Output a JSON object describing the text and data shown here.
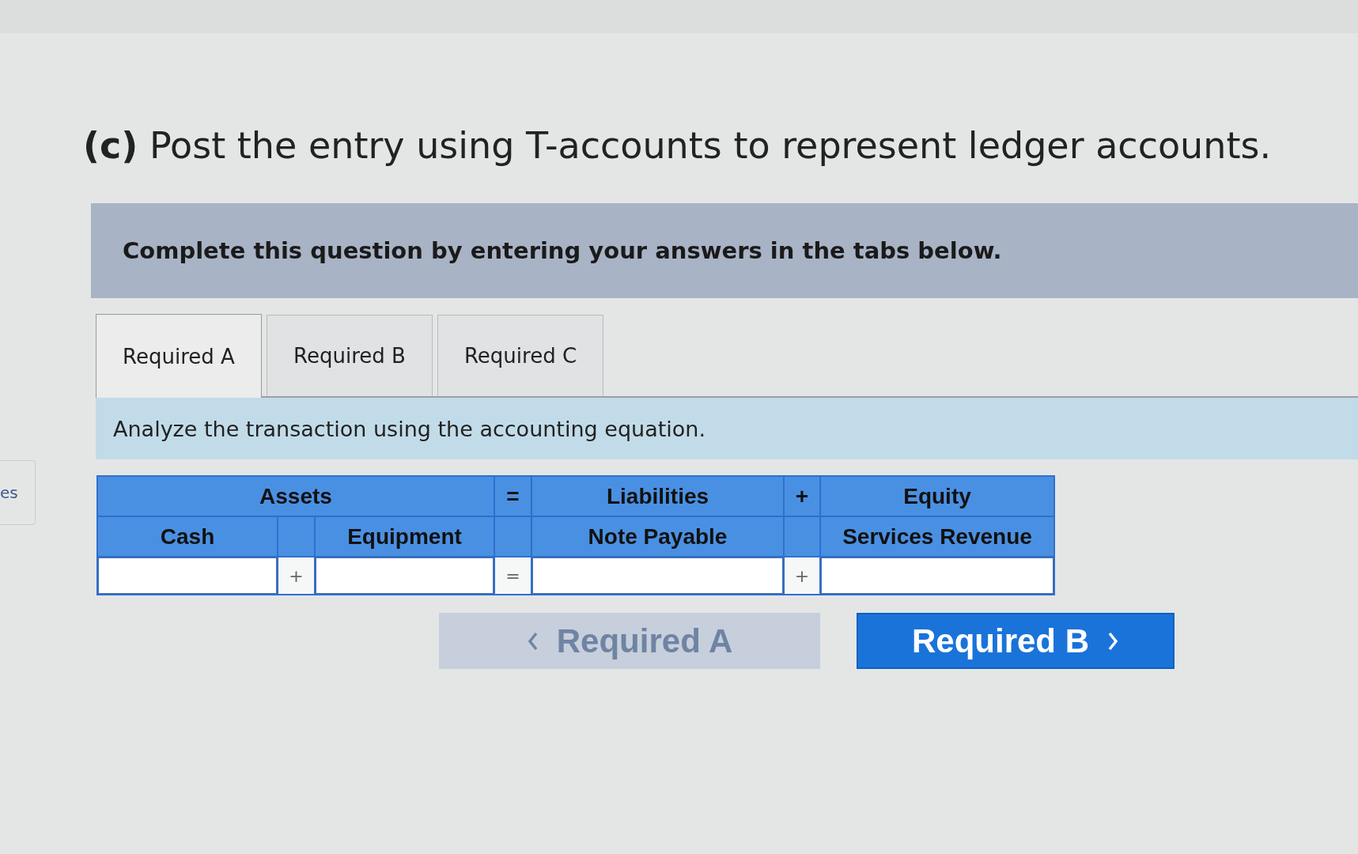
{
  "side_panel": {
    "text": "es"
  },
  "title": "**(c)** Post the entry using T-accounts to represent ledger accounts.",
  "instruction": "Complete this question by entering your answers in the tabs below.",
  "tabs": [
    {
      "label": "Required A",
      "selected": true
    },
    {
      "label": "Required B",
      "selected": false
    },
    {
      "label": "Required C",
      "selected": false
    }
  ],
  "prompt": "Analyze the transaction using the accounting equation.",
  "equation": [
    {
      "kind": "group",
      "label": "Assets",
      "accounts": [
        {
          "name": "Cash"
        },
        {
          "name": "Equipment"
        }
      ],
      "joiner": "+"
    },
    {
      "kind": "operator",
      "header_symbol": "=",
      "row_symbol": "="
    },
    {
      "kind": "group",
      "label": "Liabilities",
      "accounts": [
        {
          "name": "Note Payable"
        }
      ]
    },
    {
      "kind": "operator",
      "header_symbol": "+",
      "row_symbol": "+"
    },
    {
      "kind": "group",
      "label": "Equity",
      "accounts": [
        {
          "name": "Services Revenue"
        }
      ]
    }
  ],
  "buttons": [
    {
      "kind": "prev",
      "label": "Required A",
      "disabled": true
    },
    {
      "kind": "next",
      "label": "Required B",
      "disabled": false
    }
  ]
}
